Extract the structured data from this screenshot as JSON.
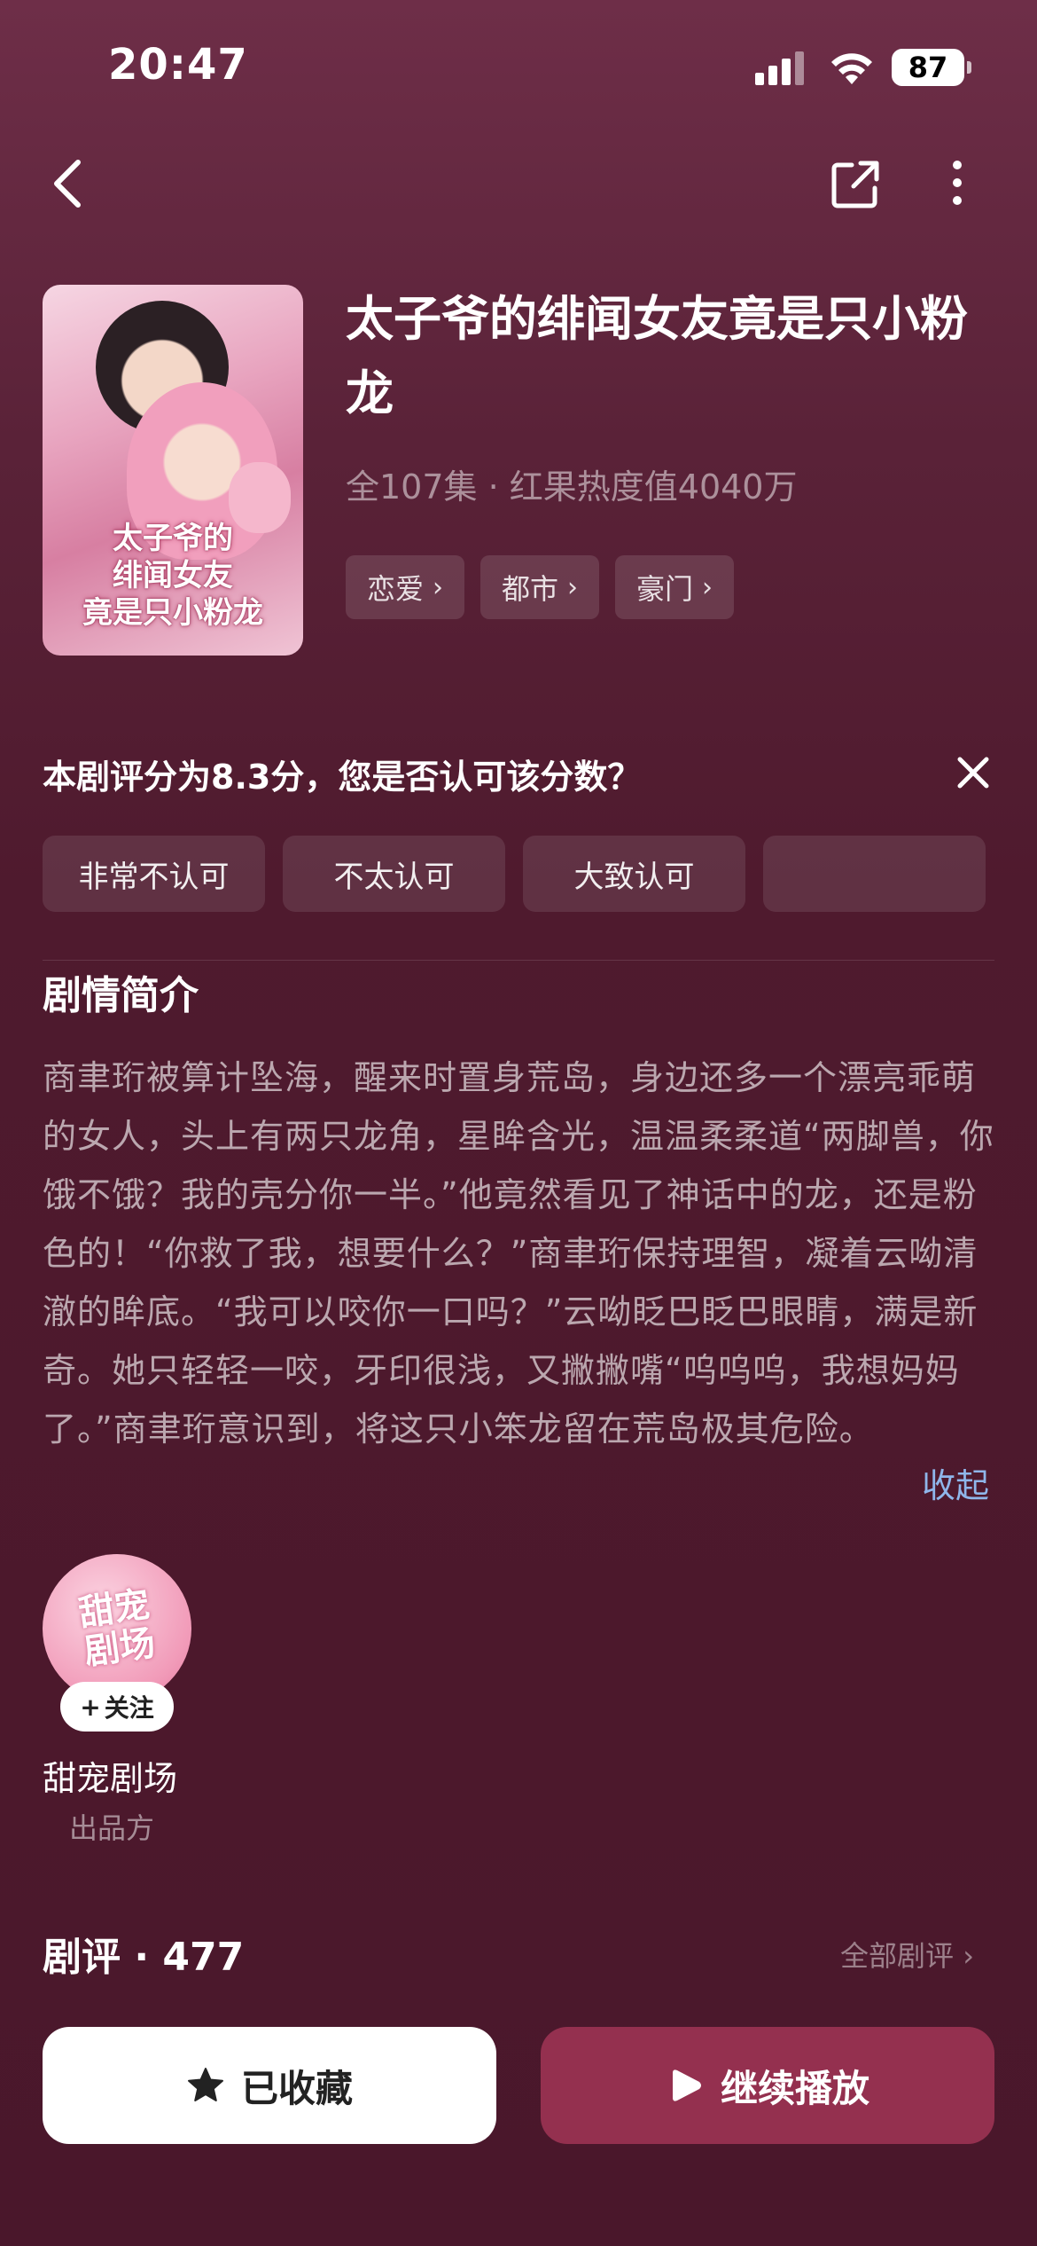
{
  "status_bar": {
    "time": "20:47",
    "battery": "87"
  },
  "nav": {
    "back_icon": "chevron-left-icon",
    "share_icon": "share-icon",
    "more_icon": "more-vertical-icon"
  },
  "drama": {
    "cover_text_line1": "太子爷的",
    "cover_text_line2": "绯闻女友",
    "cover_text_line3": "竟是只小粉龙",
    "title": "太子爷的绯闻女友竟是只小粉龙",
    "meta": "全107集 · 红果热度值4040万",
    "tags": [
      "恋爱",
      "都市",
      "豪门"
    ]
  },
  "rating": {
    "question": "本剧评分为8.3分，您是否认可该分数？",
    "options": [
      "非常不认可",
      "不太认可",
      "大致认可",
      ""
    ]
  },
  "synopsis": {
    "title": "剧情简介",
    "body": "商聿珩被算计坠海，醒来时置身荒岛，身边还多一个漂亮乖萌的女人，头上有两只龙角，星眸含光，温温柔柔道“两脚兽，你饿不饿？我的壳分你一半。”他竟然看见了神话中的龙，还是粉色的！“你救了我，想要什么？”商聿珩保持理智，凝着云呦清澈的眸底。“我可以咬你一口吗？”云呦眨巴眨巴眼睛，满是新奇。她只轻轻一咬，牙印很浅，又撇撇嘴“呜呜呜，我想妈妈了。”商聿珩意识到，将这只小笨龙留在荒岛极其危险。",
    "collapse_label": "收起"
  },
  "producer": {
    "avatar_text_line1": "甜宠",
    "avatar_text_line2": "剧场",
    "follow_label": "关注",
    "name": "甜宠剧场",
    "role": "出品方"
  },
  "reviews": {
    "title": "剧评 · 477",
    "all_label": "全部剧评"
  },
  "actions": {
    "favorite_label": "已收藏",
    "play_label": "继续播放"
  }
}
